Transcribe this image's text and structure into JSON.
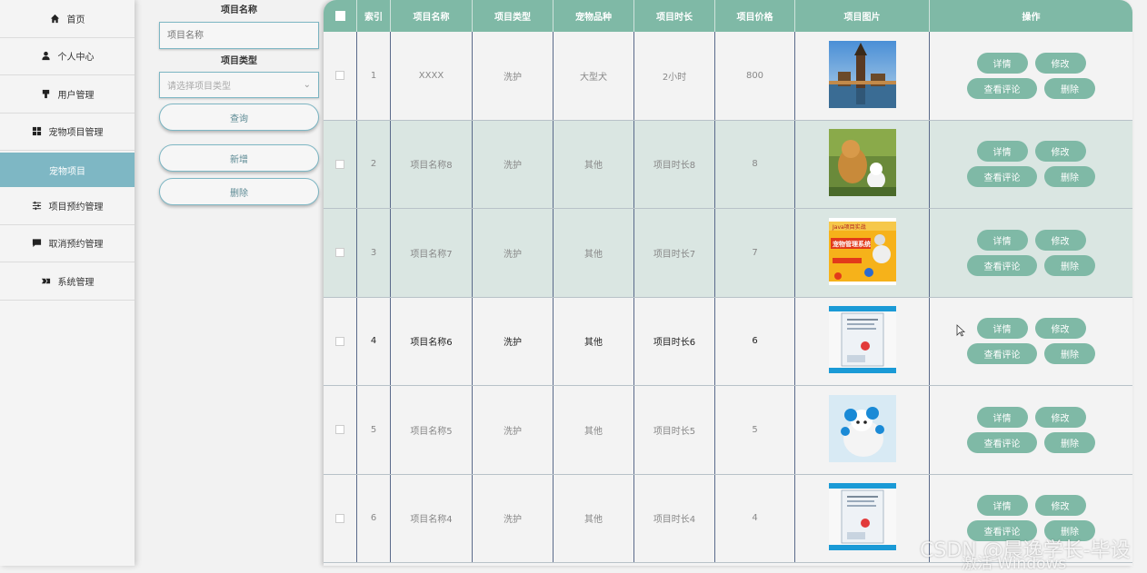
{
  "sidebar": {
    "items": [
      {
        "label": "首页",
        "icon": "home-icon"
      },
      {
        "label": "个人中心",
        "icon": "user-icon"
      },
      {
        "label": "用户管理",
        "icon": "user-manage-icon"
      },
      {
        "label": "宠物项目管理",
        "icon": "grid-icon"
      },
      {
        "label": "宠物项目",
        "icon": ""
      },
      {
        "label": "项目预约管理",
        "icon": "sliders-icon"
      },
      {
        "label": "取消预约管理",
        "icon": "chat-icon"
      },
      {
        "label": "系统管理",
        "icon": "settings-icon"
      }
    ]
  },
  "filter": {
    "name_label": "项目名称",
    "name_placeholder": "项目名称",
    "type_label": "项目类型",
    "type_placeholder": "请选择项目类型",
    "search_button": "查询",
    "add_button": "新增",
    "delete_button": "删除"
  },
  "table": {
    "headers": [
      "索引",
      "项目名称",
      "项目类型",
      "宠物品种",
      "项目时长",
      "项目价格",
      "项目图片",
      "操作"
    ],
    "actions": {
      "detail": "详情",
      "edit": "修改",
      "comments": "查看评论",
      "delete": "删除"
    },
    "rows": [
      {
        "index": "1",
        "name": "XXXX",
        "type": "洗护",
        "breed": "大型犬",
        "duration": "2小时",
        "price": "800",
        "image": "castle-photo"
      },
      {
        "index": "2",
        "name": "项目名称8",
        "type": "洗护",
        "breed": "其他",
        "duration": "项目时长8",
        "price": "8",
        "image": "dogs-photo"
      },
      {
        "index": "3",
        "name": "项目名称7",
        "type": "洗护",
        "breed": "其他",
        "duration": "项目时长7",
        "price": "7",
        "image": "banner-poster"
      },
      {
        "index": "4",
        "name": "项目名称6",
        "type": "洗护",
        "breed": "其他",
        "duration": "项目时长6",
        "price": "6",
        "image": "document-poster"
      },
      {
        "index": "5",
        "name": "项目名称5",
        "type": "洗护",
        "breed": "其他",
        "duration": "项目时长5",
        "price": "5",
        "image": "groomed-dog-photo"
      },
      {
        "index": "6",
        "name": "项目名称4",
        "type": "洗护",
        "breed": "其他",
        "duration": "项目时长4",
        "price": "4",
        "image": "document-poster"
      }
    ]
  },
  "thumb_banner_text": "Java项目实战",
  "thumb_banner_title": "宠物管理系统",
  "watermark": {
    "line1": "CSDN @晨逸学长-毕设",
    "line2": "激活 Windows"
  },
  "colors": {
    "accent": "#7fb9a6",
    "sidebar_active": "#7eb7c4",
    "row_tint": "#dae6e2"
  }
}
